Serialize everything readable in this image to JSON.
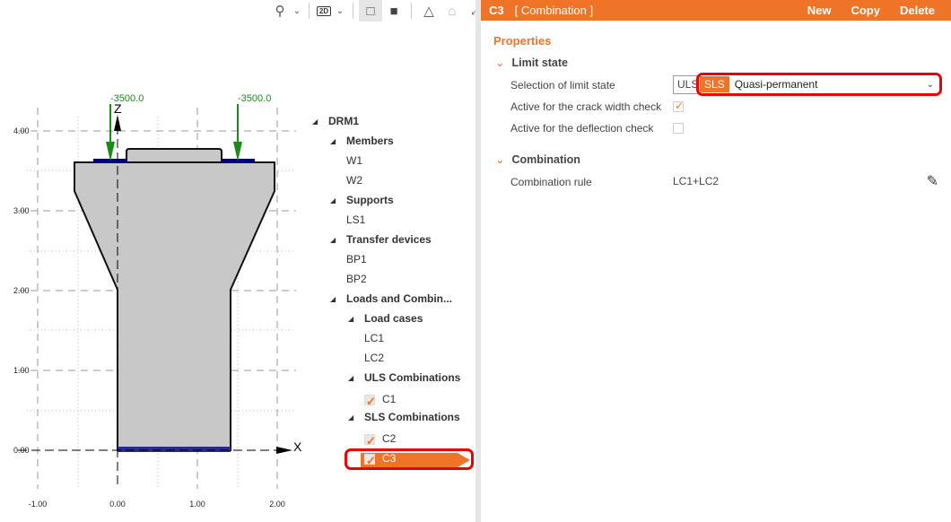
{
  "toolbar": {
    "icons": [
      "search-icon",
      "chevron-down-icon",
      "2d-view-icon",
      "chevron-down-icon",
      "wireframe-cube-icon",
      "solid-cube-icon",
      "section-view-icon",
      "home-icon",
      "fullscreen-icon"
    ],
    "view_2d_label": "2D"
  },
  "viewport": {
    "loads": [
      {
        "label": "-3500.0"
      },
      {
        "label": "-3500.0"
      }
    ],
    "axis_x": "X",
    "axis_z": "Z",
    "x_ticks": [
      "-1.00",
      "0.00",
      "1.00",
      "2.00"
    ],
    "y_ticks": [
      "0.00",
      "1.00",
      "2.00",
      "3.00",
      "4.00"
    ],
    "colors": {
      "load": "#1a8a1a",
      "section": "#c8c8c8",
      "bearing": "#000080"
    }
  },
  "tree": {
    "root": "DRM1",
    "members_label": "Members",
    "members": [
      "W1",
      "W2"
    ],
    "supports_label": "Supports",
    "supports": [
      "LS1"
    ],
    "transfer_label": "Transfer devices",
    "transfer": [
      "BP1",
      "BP2"
    ],
    "loads_label": "Loads and Combin...",
    "load_cases_label": "Load cases",
    "load_cases": [
      "LC1",
      "LC2"
    ],
    "uls_label": "ULS Combinations",
    "uls": [
      "C1"
    ],
    "sls_label": "SLS Combinations",
    "sls": [
      "C2",
      "C3"
    ],
    "selected": "C3"
  },
  "panel": {
    "header": {
      "id": "C3",
      "type": "[ Combination ]",
      "new": "New",
      "copy": "Copy",
      "delete": "Delete"
    },
    "title": "Properties",
    "limit_state": {
      "section": "Limit state",
      "selection_label": "Selection of limit state",
      "uls": "ULS",
      "sls": "SLS",
      "value": "Quasi-permanent",
      "crack_label": "Active for the crack width check",
      "crack_checked": true,
      "deflection_label": "Active for the deflection check",
      "deflection_checked": false
    },
    "combination": {
      "section": "Combination",
      "rule_label": "Combination rule",
      "rule_value": "LC1+LC2"
    }
  },
  "colors": {
    "accent": "#f07428",
    "highlight": "#e00000"
  }
}
